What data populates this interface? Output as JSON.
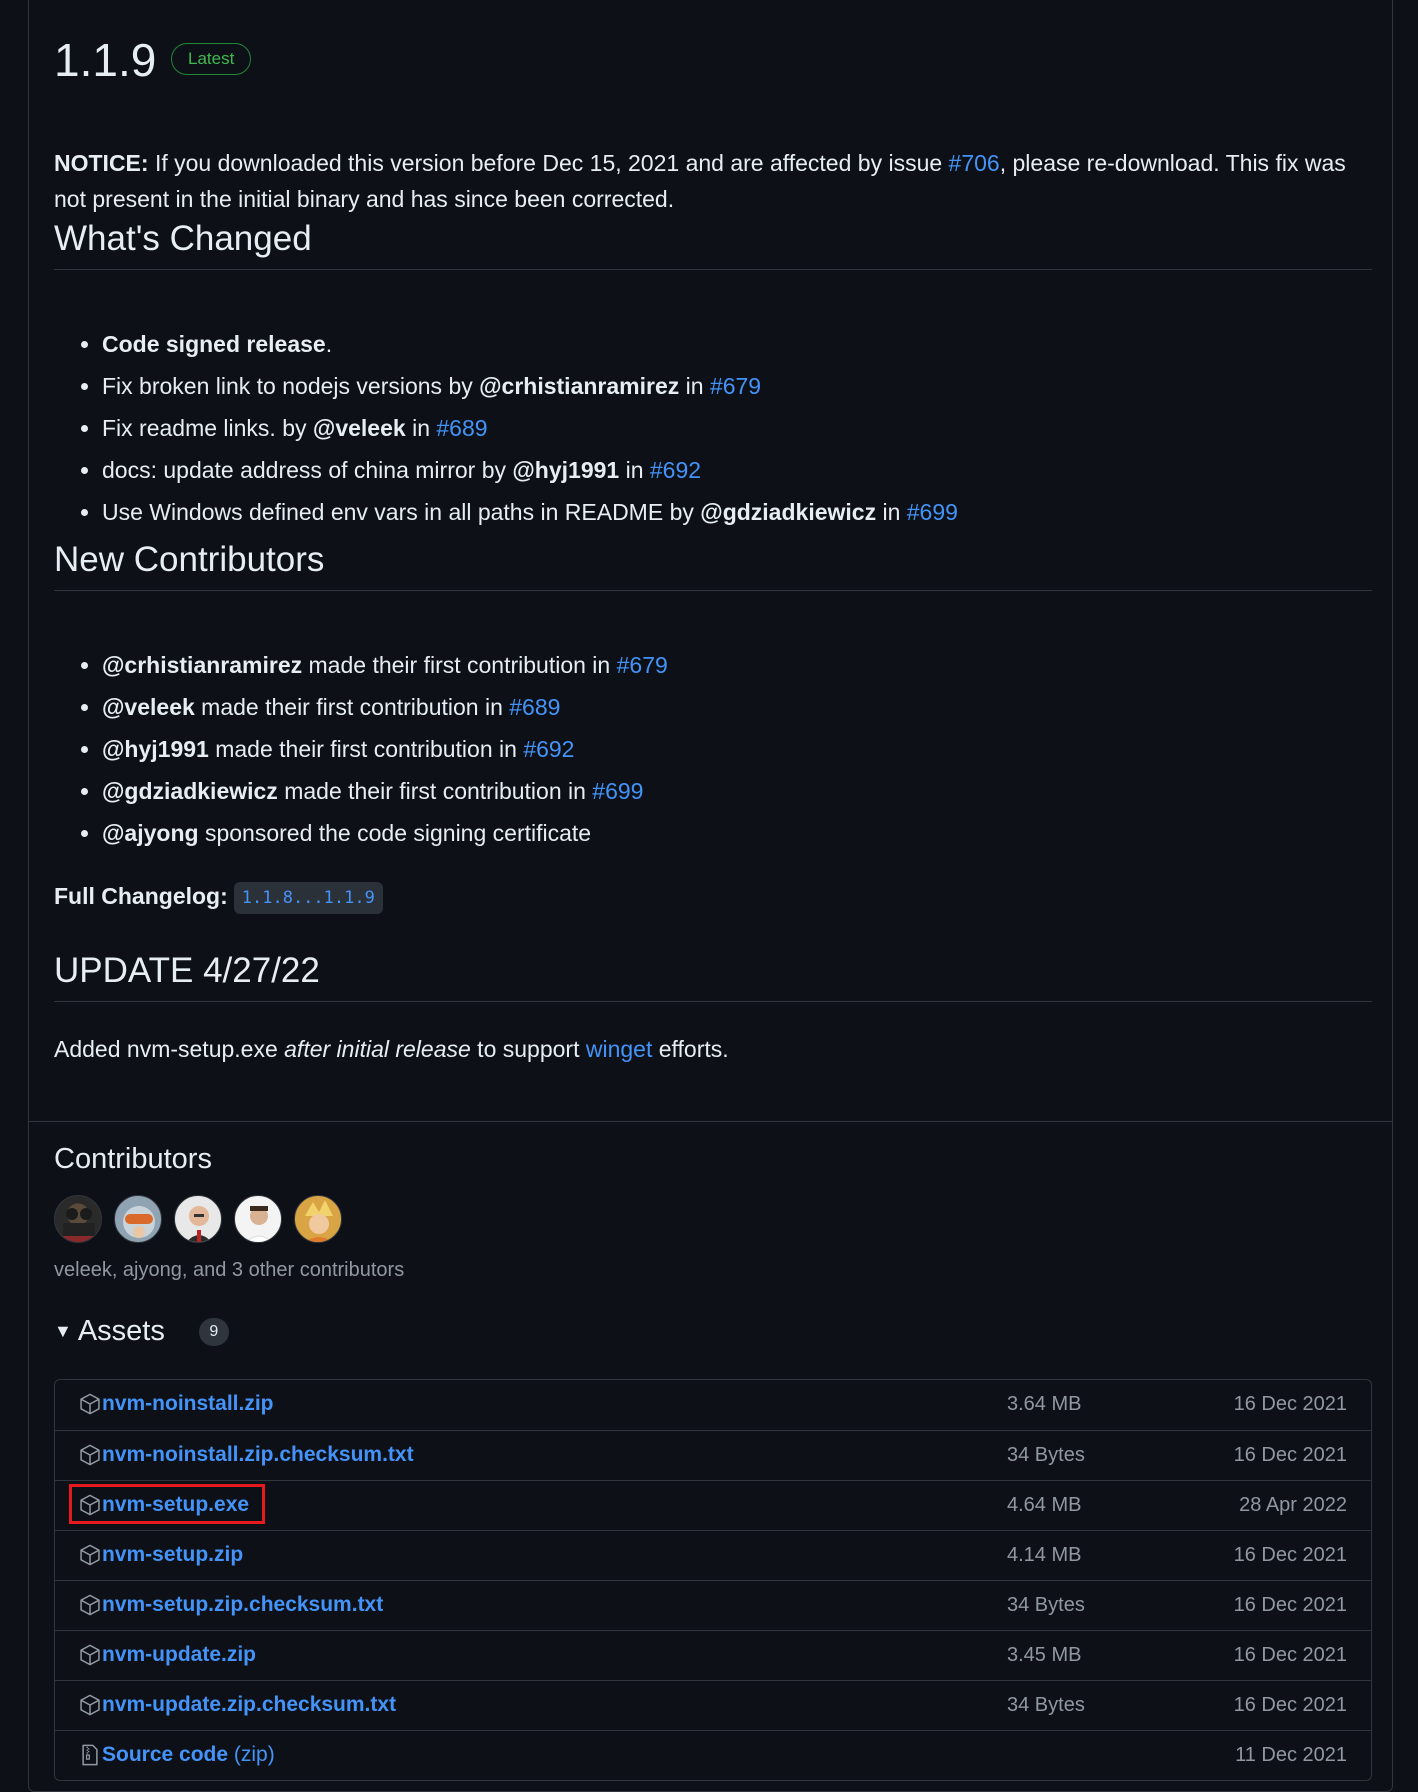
{
  "release": {
    "version": "1.1.9",
    "badge": "Latest",
    "notice": {
      "label": "NOTICE:",
      "text_before": " If you downloaded this version before Dec 15, 2021 and are affected by issue ",
      "issue_link": "#706",
      "text_after": ", please re-download. This fix was not present in the initial binary and has since been corrected."
    },
    "whats_changed": {
      "heading": "What's Changed",
      "items": [
        {
          "bold": "Code signed release",
          "text": ".",
          "user": "",
          "in": "",
          "link": ""
        },
        {
          "bold": "",
          "text": "Fix broken link to nodejs versions by ",
          "user": "@crhistianramirez",
          "in": " in ",
          "link": "#679"
        },
        {
          "bold": "",
          "text": "Fix readme links. by ",
          "user": "@veleek",
          "in": " in ",
          "link": "#689"
        },
        {
          "bold": "",
          "text": "docs: update address of china mirror by ",
          "user": "@hyj1991",
          "in": " in ",
          "link": "#692"
        },
        {
          "bold": "",
          "text": "Use Windows defined env vars in all paths in README by ",
          "user": "@gdziadkiewicz",
          "in": " in ",
          "link": "#699"
        }
      ]
    },
    "new_contributors": {
      "heading": "New Contributors",
      "items": [
        {
          "user": "@crhistianramirez",
          "text": " made their first contribution in ",
          "link": "#679"
        },
        {
          "user": "@veleek",
          "text": " made their first contribution in ",
          "link": "#689"
        },
        {
          "user": "@hyj1991",
          "text": " made their first contribution in ",
          "link": "#692"
        },
        {
          "user": "@gdziadkiewicz",
          "text": " made their first contribution in ",
          "link": "#699"
        },
        {
          "user": "@ajyong",
          "text": " sponsored the code signing certificate",
          "link": ""
        }
      ]
    },
    "changelog": {
      "label": "Full Changelog:",
      "link": "1.1.8...1.1.9"
    },
    "update": {
      "heading": "UPDATE 4/27/22",
      "text_before": "Added nvm-setup.exe ",
      "italic": "after initial release",
      "text_mid": " to support ",
      "link": "winget",
      "text_after": " efforts."
    }
  },
  "contributors": {
    "heading": "Contributors",
    "avatars": [
      "avatar-1",
      "avatar-2",
      "avatar-3",
      "avatar-4",
      "avatar-5"
    ],
    "summary": "veleek, ajyong, and 3 other contributors"
  },
  "assets": {
    "heading": "Assets",
    "count": "9",
    "rows": [
      {
        "name": "nvm-noinstall.zip",
        "suffix": "",
        "size": "3.64 MB",
        "date": "16 Dec 2021",
        "icon": "package-icon"
      },
      {
        "name": "nvm-noinstall.zip.checksum.txt",
        "suffix": "",
        "size": "34 Bytes",
        "date": "16 Dec 2021",
        "icon": "package-icon"
      },
      {
        "name": "nvm-setup.exe",
        "suffix": "",
        "size": "4.64 MB",
        "date": "28 Apr 2022",
        "icon": "package-icon",
        "highlighted": true
      },
      {
        "name": "nvm-setup.zip",
        "suffix": "",
        "size": "4.14 MB",
        "date": "16 Dec 2021",
        "icon": "package-icon"
      },
      {
        "name": "nvm-setup.zip.checksum.txt",
        "suffix": "",
        "size": "34 Bytes",
        "date": "16 Dec 2021",
        "icon": "package-icon"
      },
      {
        "name": "nvm-update.zip",
        "suffix": "",
        "size": "3.45 MB",
        "date": "16 Dec 2021",
        "icon": "package-icon"
      },
      {
        "name": "nvm-update.zip.checksum.txt",
        "suffix": "",
        "size": "34 Bytes",
        "date": "16 Dec 2021",
        "icon": "package-icon"
      },
      {
        "name": "Source code",
        "suffix": " (zip)",
        "size": "",
        "date": "11 Dec 2021",
        "icon": "file-zip-icon"
      }
    ]
  },
  "colors": {
    "background": "#0d1117",
    "link": "#4493f8",
    "badge_green": "#3fb950",
    "highlight_red": "#e5191e"
  }
}
